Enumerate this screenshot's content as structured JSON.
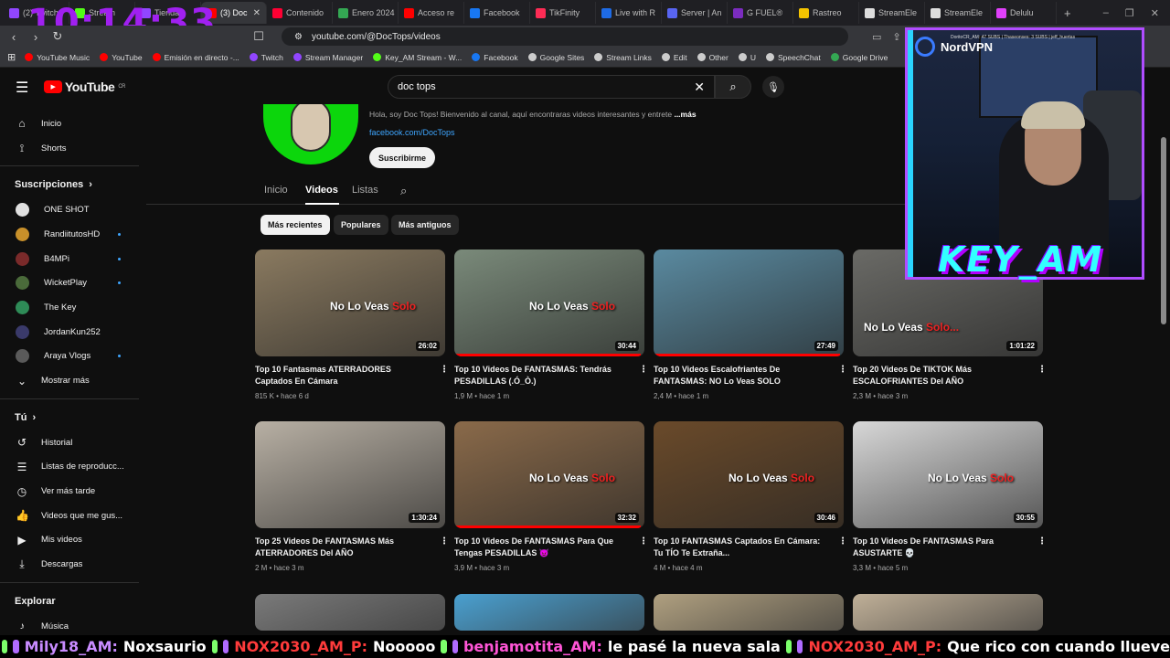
{
  "clock": "10:14:33",
  "browser": {
    "tabs": [
      {
        "label": "(2) Twitch",
        "color": "#9146ff"
      },
      {
        "label": "Stream",
        "color": "#53fc18"
      },
      {
        "label": "Tienda",
        "color": "#9146ff"
      },
      {
        "label": "(3) Doc",
        "color": "#ff0000",
        "active": true
      },
      {
        "label": "Contenido",
        "color": "#ff0033"
      },
      {
        "label": "Enero 2024",
        "color": "#34a853"
      },
      {
        "label": "Acceso re",
        "color": "#ff0000"
      },
      {
        "label": "Facebook",
        "color": "#1877f2"
      },
      {
        "label": "TikFinity",
        "color": "#fe2c55"
      },
      {
        "label": "Live with R",
        "color": "#1e6be6"
      },
      {
        "label": "Server | An",
        "color": "#5865f2"
      },
      {
        "label": "G FUEL®",
        "color": "#7b2cbf"
      },
      {
        "label": "Rastreo",
        "color": "#f5c400"
      },
      {
        "label": "StreamEle",
        "color": "#dddddd"
      },
      {
        "label": "StreamEle",
        "color": "#dddddd"
      },
      {
        "label": "Delulu",
        "color": "#e040fb"
      }
    ],
    "url": "youtube.com/@DocTops/videos",
    "bookmarks": [
      {
        "label": "YouTube Music",
        "color": "#ff0000"
      },
      {
        "label": "YouTube",
        "color": "#ff0000"
      },
      {
        "label": "Emisión en directo -...",
        "color": "#ff0000"
      },
      {
        "label": "Twitch",
        "color": "#9146ff"
      },
      {
        "label": "Stream Manager",
        "color": "#9146ff"
      },
      {
        "label": "Key_AM Stream - W...",
        "color": "#53fc18"
      },
      {
        "label": "Facebook",
        "color": "#1877f2"
      },
      {
        "label": "Google Sites",
        "color": "#cccccc"
      },
      {
        "label": "Stream Links",
        "color": "#cccccc"
      },
      {
        "label": "Edit",
        "color": "#cccccc"
      },
      {
        "label": "Other",
        "color": "#cccccc"
      },
      {
        "label": "U",
        "color": "#cccccc"
      },
      {
        "label": "SpeechChat",
        "color": "#cccccc"
      },
      {
        "label": "Google Drive",
        "color": "#34a853"
      }
    ]
  },
  "youtube": {
    "logo_text": "YouTube",
    "logo_country": "CR",
    "search_value": "doc tops",
    "sidebar": {
      "main": [
        {
          "label": "Inicio",
          "icon": "home-icon",
          "glyph": "⌂"
        },
        {
          "label": "Shorts",
          "icon": "shorts-icon",
          "glyph": "⟟"
        }
      ],
      "subs_heading": "Suscripciones",
      "subs": [
        {
          "label": "ONE SHOT",
          "color": "#e0e0e0",
          "dot": false
        },
        {
          "label": "RandiitutosHD",
          "color": "#c8902a",
          "dot": true
        },
        {
          "label": "B4MPi",
          "color": "#7a2a2a",
          "dot": true
        },
        {
          "label": "WicketPlay",
          "color": "#4a6a3a",
          "dot": true
        },
        {
          "label": "The Key",
          "color": "#2e8b57",
          "dot": false
        },
        {
          "label": "JordanKun252",
          "color": "#3a3a6a",
          "dot": false
        },
        {
          "label": "Araya Vlogs",
          "color": "#5a5a5a",
          "dot": true
        }
      ],
      "more_label": "Mostrar más",
      "you_heading": "Tú",
      "you": [
        {
          "label": "Historial",
          "icon": "history-icon",
          "glyph": "↺"
        },
        {
          "label": "Listas de reproducc...",
          "icon": "playlists-icon",
          "glyph": "☰"
        },
        {
          "label": "Ver más tarde",
          "icon": "watch-later-icon",
          "glyph": "◷"
        },
        {
          "label": "Videos que me gus...",
          "icon": "like-icon",
          "glyph": "👍"
        },
        {
          "label": "Mis videos",
          "icon": "my-videos-icon",
          "glyph": "▶"
        },
        {
          "label": "Descargas",
          "icon": "downloads-icon",
          "glyph": "⤓"
        }
      ],
      "explore_heading": "Explorar",
      "explore": [
        {
          "label": "Música",
          "icon": "music-icon",
          "glyph": "♪"
        }
      ]
    },
    "channel": {
      "description": "Hola, soy Doc Tops! Bienvenido al canal, aquí encontraras videos interesantes y entrete",
      "more": "...más",
      "link": "facebook.com/DocTops",
      "subscribe": "Suscribirme",
      "tabs": [
        "Inicio",
        "Videos",
        "Listas"
      ],
      "active_tab": "Videos"
    },
    "chips": [
      "Más recientes",
      "Populares",
      "Más antiguos"
    ],
    "videos": [
      {
        "title": "Top 10 Fantasmas ATERRADORES Captados En Cámara",
        "meta": "815 K • hace 6 d",
        "duration": "26:02",
        "bg": "#8a7a60",
        "cap1": "No Lo Veas",
        "cap2": "Solo",
        "progress": 0
      },
      {
        "title": "Top 10 Videos De FANTASMAS: Tendrás PESADILLAS (.Ó_Ò.)",
        "meta": "1,9 M • hace 1 m",
        "duration": "30:44",
        "bg": "#7a8a7a",
        "cap1": "No Lo Veas",
        "cap2": "Solo",
        "progress": 0.98
      },
      {
        "title": "Top 10 Videos Escalofriantes De FANTASMAS: NO Lo Veas SOLO",
        "meta": "2,4 M • hace 1 m",
        "duration": "27:49",
        "bg": "#5a8aa0",
        "cap1": "",
        "cap2": "",
        "progress": 0.98
      },
      {
        "title": "Top 20 Videos De TIKTOK Más ESCALOFRIANTES Del AÑO",
        "meta": "2,3 M • hace 3 m",
        "duration": "1:01:22",
        "bg": "#6a6a66",
        "cap1": "No Lo Veas",
        "cap2": "Solo...",
        "progress": 0
      },
      {
        "title": "Top 25 Videos De FANTASMAS Más ATERRADORES Del AÑO",
        "meta": "2 M • hace 3 m",
        "duration": "1:30:24",
        "bg": "#b8b0a4",
        "cap1": "",
        "cap2": "",
        "progress": 0
      },
      {
        "title": "Top 10 Videos De FANTASMAS Para Que Tengas PESADILLAS 👿",
        "meta": "3,9 M • hace 3 m",
        "duration": "32:32",
        "bg": "#8a6a4a",
        "cap1": "No Lo Veas",
        "cap2": "Solo",
        "progress": 0.98
      },
      {
        "title": "Top 10 FANTASMAS Captados En Cámara: Tu TÍO Te Extraña...",
        "meta": "4 M • hace 4 m",
        "duration": "30:46",
        "bg": "#6a4a2a",
        "cap1": "No Lo Veas",
        "cap2": "Solo",
        "progress": 0
      },
      {
        "title": "Top 10 Videos De FANTASMAS Para ASUSTARTE 💀",
        "meta": "3,3 M • hace 5 m",
        "duration": "30:55",
        "bg": "#d8d8d8",
        "cap1": "No Lo Veas",
        "cap2": "Solo",
        "progress": 0
      }
    ],
    "row3_thumbs": [
      "#7a7a7a",
      "#4aa0d0",
      "#b0a080",
      "#c0b098"
    ]
  },
  "overlay": {
    "vpn": "NordVPN",
    "name": "KEY_AM",
    "cam_text": "DoritoCR_AM: 47 SUBS | Thaseonses: 3 SUBS | jeff_huertas"
  },
  "chat": [
    {
      "user": "Mily18_AM:",
      "msg": "Noxsaurio",
      "cls": "u"
    },
    {
      "user": "NOX2030_AM_P:",
      "msg": "Nooooo",
      "cls": "u red"
    },
    {
      "user": "benjamotita_AM:",
      "msg": "le pasé la nueva sala",
      "cls": "u pink"
    },
    {
      "user": "NOX2030_AM_P:",
      "msg": "Que rico con cuando llueve",
      "cls": "u red"
    }
  ]
}
